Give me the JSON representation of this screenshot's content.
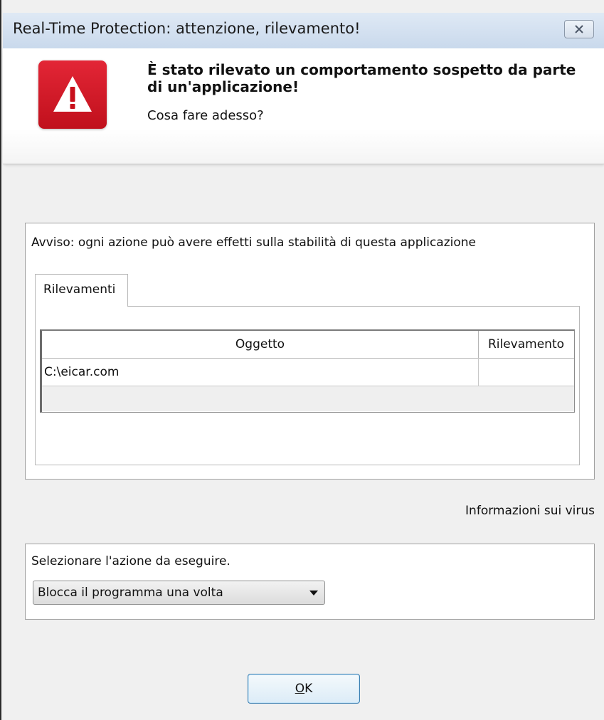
{
  "window": {
    "title": "Real-Time Protection: attenzione, rilevamento!",
    "close_icon": "close-icon"
  },
  "header": {
    "icon": "warning-icon",
    "headline": "È stato rilevato un comportamento sospetto da parte di un'applicazione!",
    "subline": "Cosa fare adesso?",
    "accent_color": "#d41b27"
  },
  "detections": {
    "warning": "Avviso: ogni azione può avere effetti sulla stabilità di questa applicazione",
    "tab_label": "Rilevamenti",
    "columns": [
      "Oggetto",
      "Rilevamento"
    ],
    "rows": [
      {
        "object": "C:\\eicar.com",
        "detection": ""
      }
    ]
  },
  "virus_info_link": "Informazioni sui virus",
  "action": {
    "label": "Selezionare l'azione da eseguire.",
    "selected": "Blocca il programma una volta"
  },
  "buttons": {
    "ok_label": "OK"
  }
}
